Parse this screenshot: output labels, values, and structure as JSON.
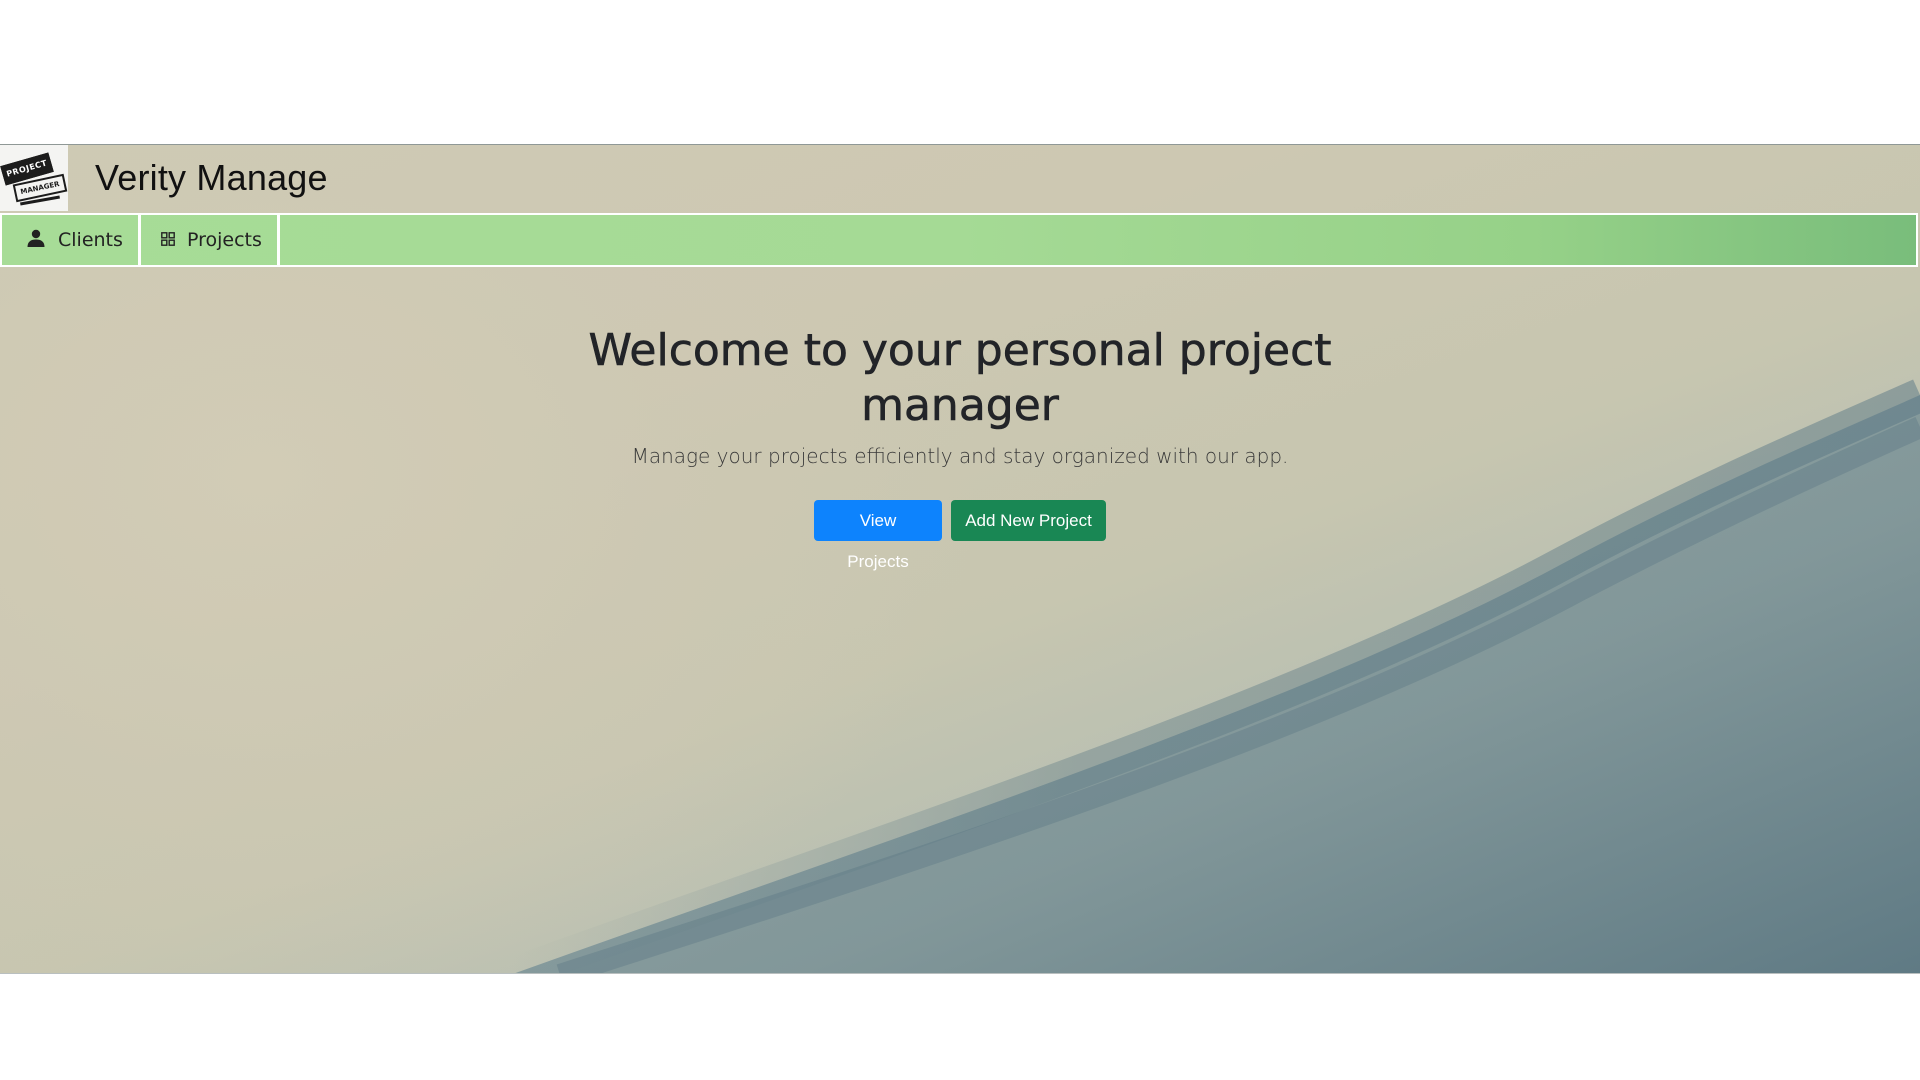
{
  "header": {
    "brand_name": "Verity Manage",
    "logo": {
      "name": "project-manager-logo",
      "text_line1": "PROJECT",
      "text_line2": "MANAGER"
    }
  },
  "nav": {
    "items": [
      {
        "label": "Clients",
        "icon": "person-icon"
      },
      {
        "label": "Projects",
        "icon": "grid-icon"
      }
    ]
  },
  "hero": {
    "title": "Welcome to your personal project manager",
    "subtitle": "Manage your projects efficiently and stay organized with our app.",
    "buttons": {
      "view_projects": "View Projects",
      "add_new_project": "Add New Project"
    }
  },
  "colors": {
    "navbar": "#a7dc97",
    "primary_button": "#0d83fd",
    "success_button": "#198754"
  }
}
